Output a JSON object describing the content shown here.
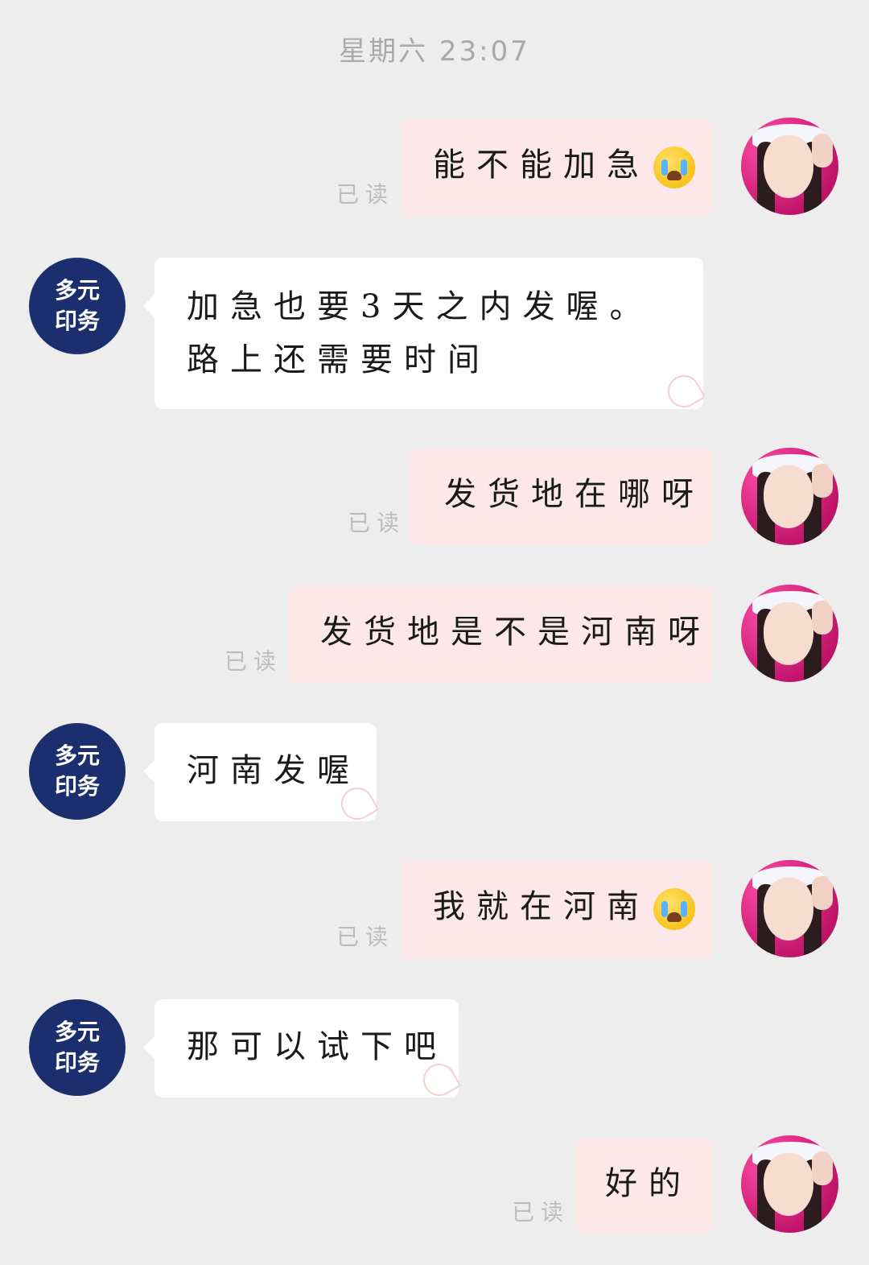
{
  "timestamp": "星期六 23:07",
  "read_label": "已读",
  "shop_avatar": {
    "line1": "多元",
    "line2": "印务"
  },
  "messages": [
    {
      "text": "能不能加急"
    },
    {
      "text": "加急也要3天之内发喔。路上还需要时间"
    },
    {
      "text": "发货地在哪呀"
    },
    {
      "text": "发货地是不是河南呀"
    },
    {
      "text": "河南发喔"
    },
    {
      "text": "我就在河南"
    },
    {
      "text": "那可以试下吧"
    },
    {
      "text": "好的"
    }
  ],
  "emoji_names": [
    "crying-face-icon"
  ],
  "colors": {
    "background": "#ededed",
    "outgoing_bubble": "#fce8e8",
    "incoming_bubble": "#ffffff",
    "shop_avatar": "#1b2f6e"
  }
}
